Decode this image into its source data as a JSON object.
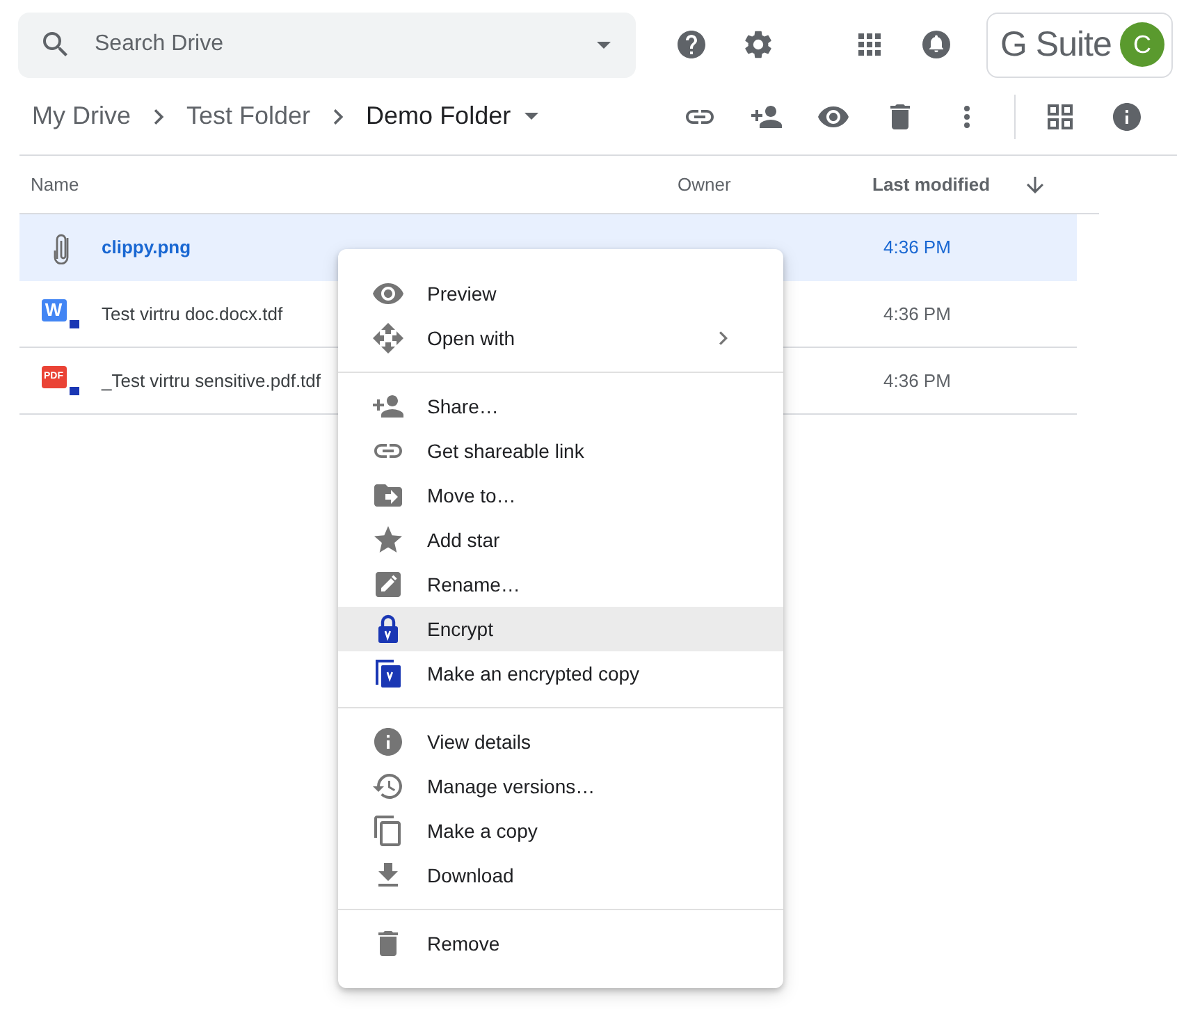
{
  "search": {
    "placeholder": "Search Drive"
  },
  "brand": {
    "logo_text": "G Suite",
    "avatar_letter": "C"
  },
  "breadcrumb": [
    {
      "label": "My Drive"
    },
    {
      "label": "Test Folder"
    },
    {
      "label": "Demo Folder"
    }
  ],
  "table": {
    "columns": [
      "Name",
      "Owner",
      "Last modified"
    ],
    "rows": [
      {
        "kind": "image",
        "name": "clippy.png",
        "modified": "4:36 PM",
        "selected": true
      },
      {
        "kind": "word",
        "icon_text": "W",
        "name": "Test virtru doc.docx.tdf",
        "modified": "4:36 PM",
        "selected": false
      },
      {
        "kind": "pdf",
        "icon_text": "PDF",
        "name": "_Test virtru sensitive.pdf.tdf",
        "modified": "4:36 PM",
        "selected": false
      }
    ]
  },
  "menu": {
    "groups": [
      [
        {
          "label": "Preview",
          "highlighted": false
        },
        {
          "label": "Open with",
          "highlighted": false,
          "has_submenu": true
        }
      ],
      [
        {
          "label": "Share…",
          "highlighted": false
        },
        {
          "label": "Get shareable link",
          "highlighted": false
        },
        {
          "label": "Move to…",
          "highlighted": false
        },
        {
          "label": "Add star",
          "highlighted": false
        },
        {
          "label": "Rename…",
          "highlighted": false
        },
        {
          "label": "Encrypt",
          "highlighted": true
        },
        {
          "label": "Make an encrypted copy",
          "highlighted": false
        }
      ],
      [
        {
          "label": "View details",
          "highlighted": false
        },
        {
          "label": "Manage versions…",
          "highlighted": false
        },
        {
          "label": "Make a copy",
          "highlighted": false
        },
        {
          "label": "Download",
          "highlighted": false
        }
      ],
      [
        {
          "label": "Remove",
          "highlighted": false
        }
      ]
    ]
  }
}
